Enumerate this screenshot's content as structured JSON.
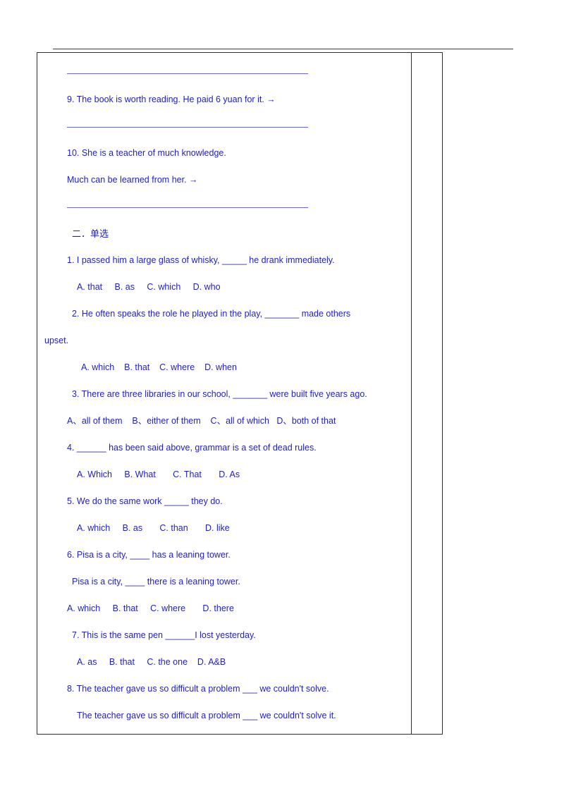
{
  "document": {
    "text_color": "#2222bb",
    "rule_color": "#6a6ad8",
    "border_color": "#2e2e2e",
    "lines": [
      {
        "id": "blank_rule_1",
        "kind": "rule",
        "text": ""
      },
      {
        "id": "q9",
        "kind": "text",
        "indent": 1,
        "text": "9. The book is worth reading. He paid 6 yuan for it. →"
      },
      {
        "id": "blank_rule_2",
        "kind": "rule",
        "text": ""
      },
      {
        "id": "q10_a",
        "kind": "text",
        "indent": 1,
        "text": "10. She is a teacher of much knowledge."
      },
      {
        "id": "q10_b",
        "kind": "text",
        "indent": 1,
        "text": "Much can be learned from her. →"
      },
      {
        "id": "blank_rule_3",
        "kind": "rule",
        "text": ""
      },
      {
        "id": "section_two",
        "kind": "text",
        "indent": 2,
        "text": "二．单选"
      },
      {
        "id": "m1_stem",
        "kind": "text",
        "indent": 1,
        "text": "1. I passed him a large glass of whisky, _____ he drank immediately."
      },
      {
        "id": "m1_opts",
        "kind": "text",
        "indent": 3,
        "text": "A. that     B. as     C. which     D. who"
      },
      {
        "id": "m2_stem",
        "kind": "text",
        "indent": 2,
        "text": "2. He often speaks the role he played in the play, _______ made others"
      },
      {
        "id": "m2_cont",
        "kind": "text",
        "indent": 0,
        "text": "upset."
      },
      {
        "id": "m2_opts",
        "kind": "text",
        "indent": 4,
        "text": "A. which    B. that    C. where    D. when"
      },
      {
        "id": "m3_stem",
        "kind": "text",
        "indent": 2,
        "text": "3. There are three libraries in our school, _______ were built five years ago."
      },
      {
        "id": "m3_opts",
        "kind": "text",
        "indent": 1,
        "text": "A、all of them    B、either of them    C、all of which   D、both of that"
      },
      {
        "id": "m4_stem",
        "kind": "text",
        "indent": 1,
        "text": "4. ______ has been said above, grammar is a set of dead rules."
      },
      {
        "id": "m4_opts",
        "kind": "text",
        "indent": 3,
        "text": "A. Which     B. What       C. That       D. As"
      },
      {
        "id": "m5_stem",
        "kind": "text",
        "indent": 1,
        "text": "5. We do the same work _____ they do."
      },
      {
        "id": "m5_opts",
        "kind": "text",
        "indent": 3,
        "text": "A. which     B. as       C. than       D. like"
      },
      {
        "id": "m6_stem_a",
        "kind": "text",
        "indent": 1,
        "text": "6. Pisa is a city, ____ has a leaning tower."
      },
      {
        "id": "m6_stem_b",
        "kind": "text",
        "indent": 2,
        "text": "Pisa is a city, ____ there is a leaning tower."
      },
      {
        "id": "m6_opts",
        "kind": "text",
        "indent": 1,
        "text": "A. which     B. that     C. where       D. there"
      },
      {
        "id": "m7_stem",
        "kind": "text",
        "indent": 2,
        "text": "7. This is the same pen ______I lost yesterday."
      },
      {
        "id": "m7_opts",
        "kind": "text",
        "indent": 3,
        "text": "A. as     B. that     C. the one    D. A&B"
      },
      {
        "id": "m8_stem_a",
        "kind": "text",
        "indent": 1,
        "text": "8. The teacher gave us so difficult a problem ___ we couldn't solve."
      },
      {
        "id": "m8_stem_b",
        "kind": "text",
        "indent": 3,
        "text": "The teacher gave us so difficult a problem ___ we couldn't solve it."
      }
    ]
  }
}
